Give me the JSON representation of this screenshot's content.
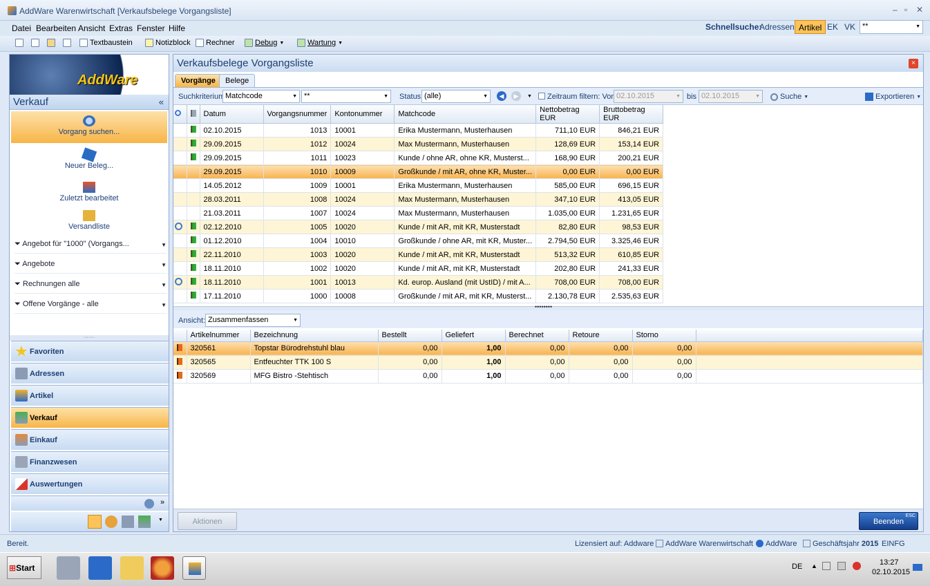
{
  "window": {
    "title": "AddWare Warenwirtschaft [Verkaufsbelege Vorgangsliste]"
  },
  "menu": [
    "Datei",
    "Bearbeiten",
    "Ansicht",
    "Extras",
    "Fenster",
    "Hilfe"
  ],
  "toolbar": {
    "textbaustein": "Textbaustein",
    "notizblock": "Notizblock",
    "rechner": "Rechner",
    "debug": "Debug",
    "wartung": "Wartung"
  },
  "schnellsuche": {
    "label": "Schnellsuche:",
    "adressen": "Adressen",
    "artikel": "Artikel",
    "ek": "EK",
    "vk": "VK",
    "value": "**"
  },
  "sidebar": {
    "logo": "AddWare",
    "title": "Verkauf",
    "actions": [
      "Vorgang suchen...",
      "Neuer Beleg...",
      "Zuletzt bearbeitet",
      "Versandliste"
    ],
    "filters": [
      "Angebot für \"1000\" (Vorgangs...",
      "Angebote",
      "Rechnungen alle",
      "Offene Vorgänge - alle"
    ],
    "modules": [
      "Favoriten",
      "Adressen",
      "Artikel",
      "Verkauf",
      "Einkauf",
      "Finanzwesen",
      "Auswertungen"
    ]
  },
  "main": {
    "title": "Verkaufsbelege Vorgangsliste",
    "tabs": [
      "Vorgänge",
      "Belege"
    ],
    "filter": {
      "suchkriterium_label": "Suchkriterium",
      "suchkriterium": "Matchcode",
      "search": "**",
      "status_label": "Status",
      "status": "(alle)",
      "zeitraum": "Zeitraum filtern: Von",
      "von": "02.10.2015",
      "bis_label": "bis",
      "bis": "02.10.2015",
      "suche": "Suche",
      "exportieren": "Exportieren"
    },
    "columns": [
      "Datum",
      "Vorgangsnummer",
      "Kontonummer",
      "Matchcode",
      "Nettobetrag EUR",
      "Bruttobetrag EUR"
    ],
    "rows": [
      {
        "datum": "02.10.2015",
        "nr": "1013",
        "konto": "10001",
        "match": "Erika Mustermann, Musterhausen",
        "netto": "711,10 EUR",
        "brutto": "846,21 EUR",
        "flag": true,
        "sync": false
      },
      {
        "datum": "29.09.2015",
        "nr": "1012",
        "konto": "10024",
        "match": "Max Mustermann, Musterhausen",
        "netto": "128,69 EUR",
        "brutto": "153,14 EUR",
        "flag": true,
        "sync": false
      },
      {
        "datum": "29.09.2015",
        "nr": "1011",
        "konto": "10023",
        "match": "Kunde / ohne AR, ohne KR, Musterst...",
        "netto": "168,90 EUR",
        "brutto": "200,21 EUR",
        "flag": true,
        "sync": false
      },
      {
        "datum": "29.09.2015",
        "nr": "1010",
        "konto": "10009",
        "match": "Großkunde / mit AR, ohne KR, Muster...",
        "netto": "0,00 EUR",
        "brutto": "0,00 EUR",
        "flag": false,
        "sync": false
      },
      {
        "datum": "14.05.2012",
        "nr": "1009",
        "konto": "10001",
        "match": "Erika Mustermann, Musterhausen",
        "netto": "585,00 EUR",
        "brutto": "696,15 EUR",
        "flag": false,
        "sync": false
      },
      {
        "datum": "28.03.2011",
        "nr": "1008",
        "konto": "10024",
        "match": "Max Mustermann, Musterhausen",
        "netto": "347,10 EUR",
        "brutto": "413,05 EUR",
        "flag": false,
        "sync": false
      },
      {
        "datum": "21.03.2011",
        "nr": "1007",
        "konto": "10024",
        "match": "Max Mustermann, Musterhausen",
        "netto": "1.035,00 EUR",
        "brutto": "1.231,65 EUR",
        "flag": false,
        "sync": false
      },
      {
        "datum": "02.12.2010",
        "nr": "1005",
        "konto": "10020",
        "match": "Kunde / mit AR, mit KR, Musterstadt",
        "netto": "82,80 EUR",
        "brutto": "98,53 EUR",
        "flag": true,
        "sync": true
      },
      {
        "datum": "01.12.2010",
        "nr": "1004",
        "konto": "10010",
        "match": "Großkunde / ohne AR, mit KR, Muster...",
        "netto": "2.794,50 EUR",
        "brutto": "3.325,46 EUR",
        "flag": true,
        "sync": false
      },
      {
        "datum": "22.11.2010",
        "nr": "1003",
        "konto": "10020",
        "match": "Kunde / mit AR, mit KR, Musterstadt",
        "netto": "513,32 EUR",
        "brutto": "610,85 EUR",
        "flag": true,
        "sync": false
      },
      {
        "datum": "18.11.2010",
        "nr": "1002",
        "konto": "10020",
        "match": "Kunde / mit AR, mit KR, Musterstadt",
        "netto": "202,80 EUR",
        "brutto": "241,33 EUR",
        "flag": true,
        "sync": false
      },
      {
        "datum": "18.11.2010",
        "nr": "1001",
        "konto": "10013",
        "match": "Kd. europ. Ausland (mit UstID) / mit A...",
        "netto": "708,00 EUR",
        "brutto": "708,00 EUR",
        "flag": true,
        "sync": true
      },
      {
        "datum": "17.11.2010",
        "nr": "1000",
        "konto": "10008",
        "match": "Großkunde / mit AR, mit KR, Musterst...",
        "netto": "2.130,78 EUR",
        "brutto": "2.535,63 EUR",
        "flag": true,
        "sync": false
      }
    ],
    "ansicht_label": "Ansicht:",
    "ansicht": "Zusammenfassen",
    "detail_columns": [
      "Artikelnummer",
      "Bezeichnung",
      "Bestellt",
      "Geliefert",
      "Berechnet",
      "Retoure",
      "Storno"
    ],
    "detail_rows": [
      {
        "nr": "320561",
        "bez": "Topstar Bürodrehstuhl blau",
        "bestellt": "0,00",
        "geliefert": "1,00",
        "berechnet": "0,00",
        "retoure": "0,00",
        "storno": "0,00"
      },
      {
        "nr": "320565",
        "bez": "Entfeuchter TTK 100 S",
        "bestellt": "0,00",
        "geliefert": "1,00",
        "berechnet": "0,00",
        "retoure": "0,00",
        "storno": "0,00"
      },
      {
        "nr": "320569",
        "bez": "MFG Bistro -Stehtisch",
        "bestellt": "0,00",
        "geliefert": "1,00",
        "berechnet": "0,00",
        "retoure": "0,00",
        "storno": "0,00"
      }
    ],
    "aktionen": "Aktionen",
    "beenden": "Beenden",
    "esc": "ESC"
  },
  "status": {
    "left": "Bereit.",
    "lizenz": "Lizensiert auf: Addware",
    "app": "AddWare Warenwirtschaft",
    "user": "AddWare",
    "gj_label": "Geschäftsjahr",
    "gj": "2015",
    "mode": "EINFG"
  },
  "taskbar": {
    "start": "Start",
    "lang": "DE",
    "time": "13:27",
    "date": "02.10.2015"
  }
}
